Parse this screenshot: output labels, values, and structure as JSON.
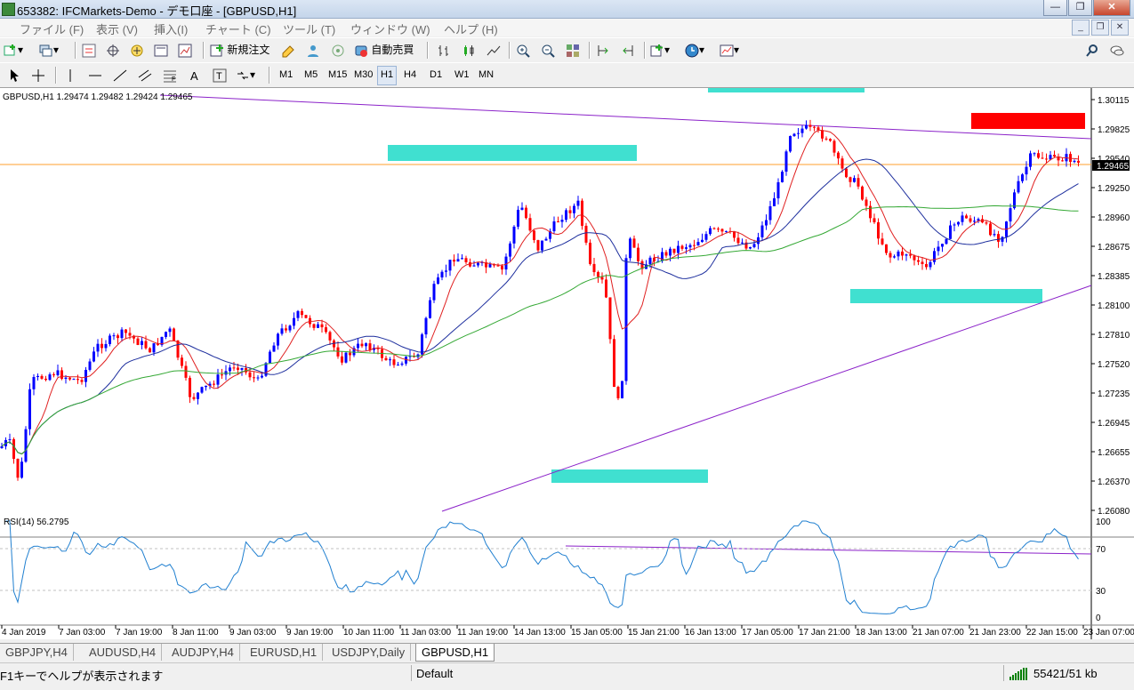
{
  "window": {
    "title": "653382: IFCMarkets-Demo - デモ口座 - [GBPUSD,H1]",
    "buttons": {
      "minimize": "—",
      "maximize": "❐",
      "close": "✕"
    }
  },
  "menu": {
    "items": [
      "ファイル (F)",
      "表示 (V)",
      "挿入(I)",
      "チャート (C)",
      "ツール (T)",
      "ウィンドウ (W)",
      "ヘルプ (H)"
    ]
  },
  "toolbar": {
    "new_order": "新規注文",
    "autotrade": "自動売買"
  },
  "timeframes": [
    "M1",
    "M5",
    "M15",
    "M30",
    "H1",
    "H4",
    "D1",
    "W1",
    "MN"
  ],
  "active_timeframe": "H1",
  "chart": {
    "symbol_info": "GBPUSD,H1  1.29474 1.29482 1.29424 1.29465",
    "current_price": "1.29465",
    "price_axis": [
      "1.30115",
      "1.29825",
      "1.29540",
      "1.29250",
      "1.28960",
      "1.28675",
      "1.28385",
      "1.28100",
      "1.27810",
      "1.27520",
      "1.27235",
      "1.26945",
      "1.26655",
      "1.26370",
      "1.26080"
    ],
    "rsi_label": "RSI(14) 56.2795",
    "rsi_axis": [
      "100",
      "70",
      "30",
      "0"
    ],
    "time_axis": [
      "4 Jan 2019",
      "7 Jan 03:00",
      "7 Jan 19:00",
      "8 Jan 11:00",
      "9 Jan 03:00",
      "9 Jan 19:00",
      "10 Jan 11:00",
      "11 Jan 03:00",
      "11 Jan 19:00",
      "14 Jan 13:00",
      "15 Jan 05:00",
      "15 Jan 21:00",
      "16 Jan 13:00",
      "17 Jan 05:00",
      "17 Jan 21:00",
      "18 Jan 13:00",
      "21 Jan 07:00",
      "21 Jan 23:00",
      "22 Jan 15:00",
      "23 Jan 07:00"
    ],
    "colors": {
      "bull": "#0000ff",
      "bear": "#ff0000",
      "ma_fast": "#e02020",
      "ma_mid": "#1e2f9e",
      "ma_slow": "#34a834",
      "trendline": "#8b22c9",
      "zone": "#40e0d0",
      "target": "#ff0000",
      "price_line": "#ff9f2e",
      "rsi": "#1f7fd0"
    }
  },
  "tabs": [
    "GBPJPY,H4",
    "AUDUSD,H4",
    "AUDJPY,H4",
    "EURUSD,H1",
    "USDJPY,Daily",
    "GBPUSD,H1"
  ],
  "active_tab": "GBPUSD,H1",
  "status": {
    "help": "F1キーでヘルプが表示されます",
    "profile": "Default",
    "traffic": "55421/51 kb"
  }
}
